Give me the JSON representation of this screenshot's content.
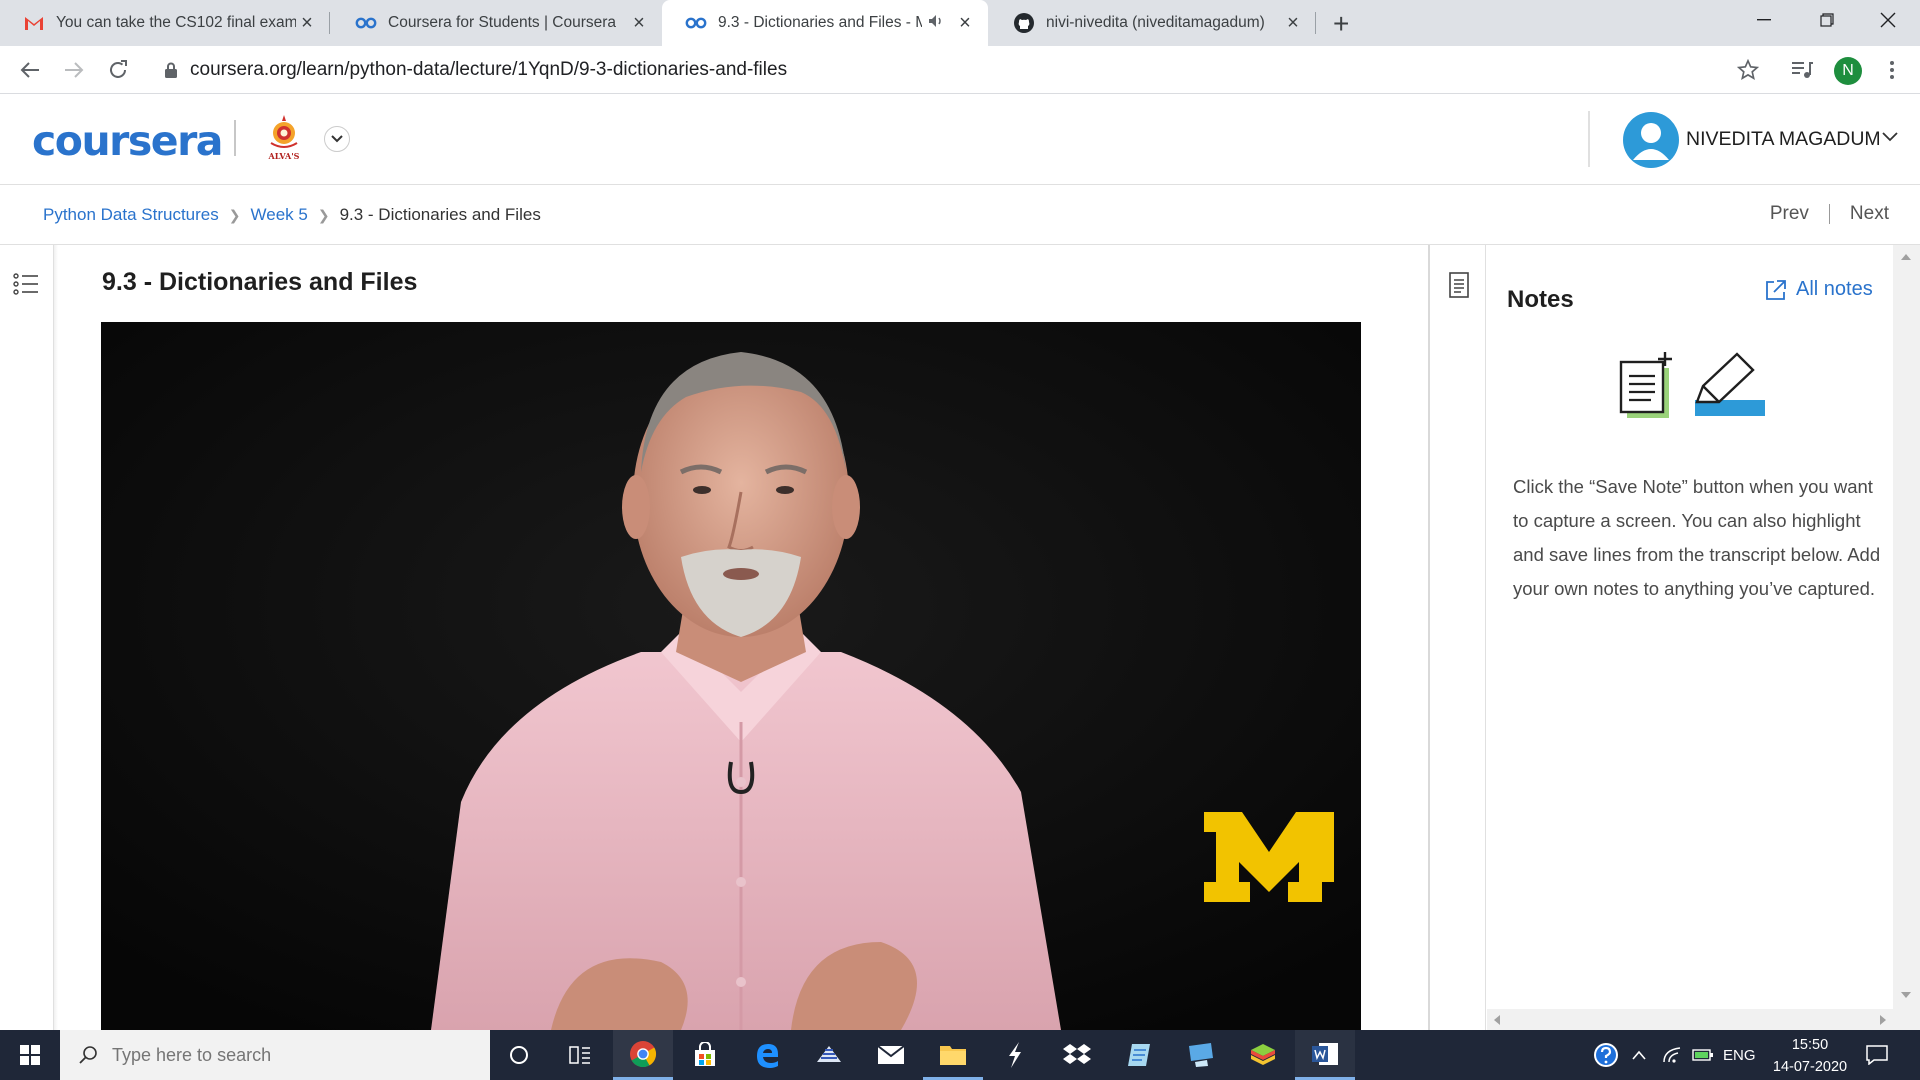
{
  "browser": {
    "tabs": [
      {
        "title": "You can take the CS102 final exam",
        "icon": "gmail-icon",
        "active": false
      },
      {
        "title": "Coursera for Students | Coursera",
        "icon": "coursera-icon",
        "active": false
      },
      {
        "title": "9.3 - Dictionaries and Files - Mo",
        "icon": "coursera-icon",
        "active": true,
        "audio": true
      },
      {
        "title": "nivi-nivedita (niveditamagadum)",
        "icon": "github-icon",
        "active": false
      }
    ],
    "url": "coursera.org/learn/python-data/lecture/1YqnD/9-3-dictionaries-and-files",
    "profile_initial": "N"
  },
  "header": {
    "logo_text": "coursera",
    "institution_label": "ALVA'S",
    "user_name": "NIVEDITA MAGADUM"
  },
  "breadcrumb": {
    "items": [
      "Python Data Structures",
      "Week 5"
    ],
    "current": "9.3 - Dictionaries and Files"
  },
  "pager": {
    "prev": "Prev",
    "next": "Next"
  },
  "lecture": {
    "title": "9.3 - Dictionaries and Files"
  },
  "notes": {
    "title": "Notes",
    "all_notes": "All notes",
    "help_text": "Click the “Save Note” button when you want to capture a screen. You can also highlight and save lines from the transcript below. Add your own notes to anything you’ve captured."
  },
  "taskbar": {
    "search_placeholder": "Type here to search",
    "language": "ENG",
    "time": "15:50",
    "date": "14-07-2020"
  },
  "colors": {
    "coursera_blue": "#2a73cc",
    "taskbar": "#1f2738",
    "michigan_maize": "#f2c300"
  }
}
